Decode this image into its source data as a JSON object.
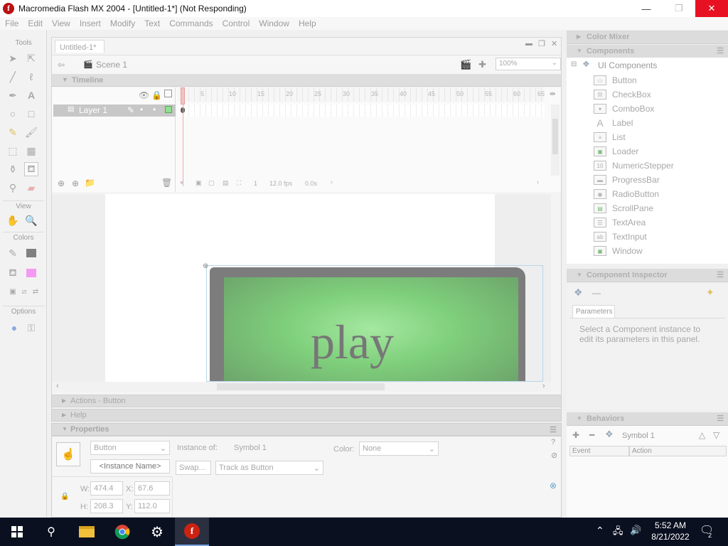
{
  "window": {
    "title": "Macromedia Flash MX 2004 - [Untitled-1*] (Not Responding)",
    "logo_glyph": "f",
    "minimize_glyph": "—",
    "maximize_glyph": "❐",
    "close_glyph": "✕"
  },
  "menu": [
    "File",
    "Edit",
    "View",
    "Insert",
    "Modify",
    "Text",
    "Commands",
    "Control",
    "Window",
    "Help"
  ],
  "tools": {
    "tools_label": "Tools",
    "view_label": "View",
    "colors_label": "Colors",
    "options_label": "Options"
  },
  "document": {
    "tab": "Untitled-1*",
    "scene": "Scene 1",
    "zoom": "100%"
  },
  "timeline": {
    "title": "Timeline",
    "layer_name": "Layer 1",
    "ticks": [
      "5",
      "10",
      "15",
      "20",
      "25",
      "30",
      "35",
      "40",
      "45",
      "50",
      "55",
      "60",
      "65"
    ],
    "current_frame": "1",
    "fps": "12.0 fps",
    "elapsed": "0.0s"
  },
  "stage": {
    "button_text": "play"
  },
  "panels": {
    "actions": "Actions - Button",
    "help": "Help",
    "properties": "Properties"
  },
  "properties": {
    "type": "Button",
    "instance_name_placeholder": "<Instance Name>",
    "instance_of_label": "Instance of:",
    "instance_of_value": "Symbol 1",
    "swap_label": "Swap...",
    "track_as": "Track as Button",
    "color_label": "Color:",
    "color_value": "None",
    "w_label": "W:",
    "w_value": "474.4",
    "h_label": "H:",
    "h_value": "208.3",
    "x_label": "X:",
    "x_value": "67.6",
    "y_label": "Y:",
    "y_value": "112.0"
  },
  "right_panels": {
    "color_mixer": "Color Mixer",
    "components": "Components",
    "ui_components": "UI Components",
    "component_items": [
      "Button",
      "CheckBox",
      "ComboBox",
      "Label",
      "List",
      "Loader",
      "NumericStepper",
      "ProgressBar",
      "RadioButton",
      "ScrollPane",
      "TextArea",
      "TextInput",
      "Window"
    ],
    "inspector_title": "Component Inspector",
    "inspector_dash": "—",
    "parameters_tab": "Parameters",
    "inspector_message": "Select a Component instance to edit its parameters in this panel.",
    "behaviors_title": "Behaviors",
    "behaviors_symbol": "Symbol 1",
    "event_col": "Event",
    "action_col": "Action"
  },
  "taskbar": {
    "time": "5:52 AM",
    "date": "8/21/2022",
    "notification_count": "2"
  }
}
